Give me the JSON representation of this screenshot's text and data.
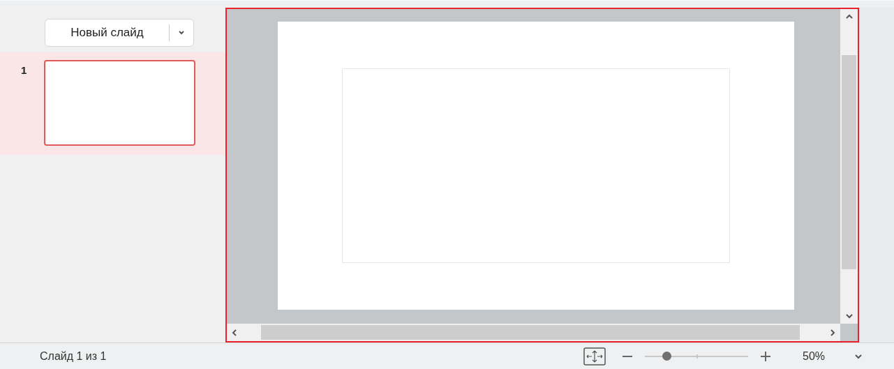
{
  "new_slide_button": {
    "label": "Новый слайд"
  },
  "slides": [
    {
      "number": "1",
      "selected": true
    }
  ],
  "status_bar": {
    "slide_counter": "Слайд 1 из 1",
    "zoom": {
      "level": 0.21,
      "reading": "50%"
    }
  }
}
